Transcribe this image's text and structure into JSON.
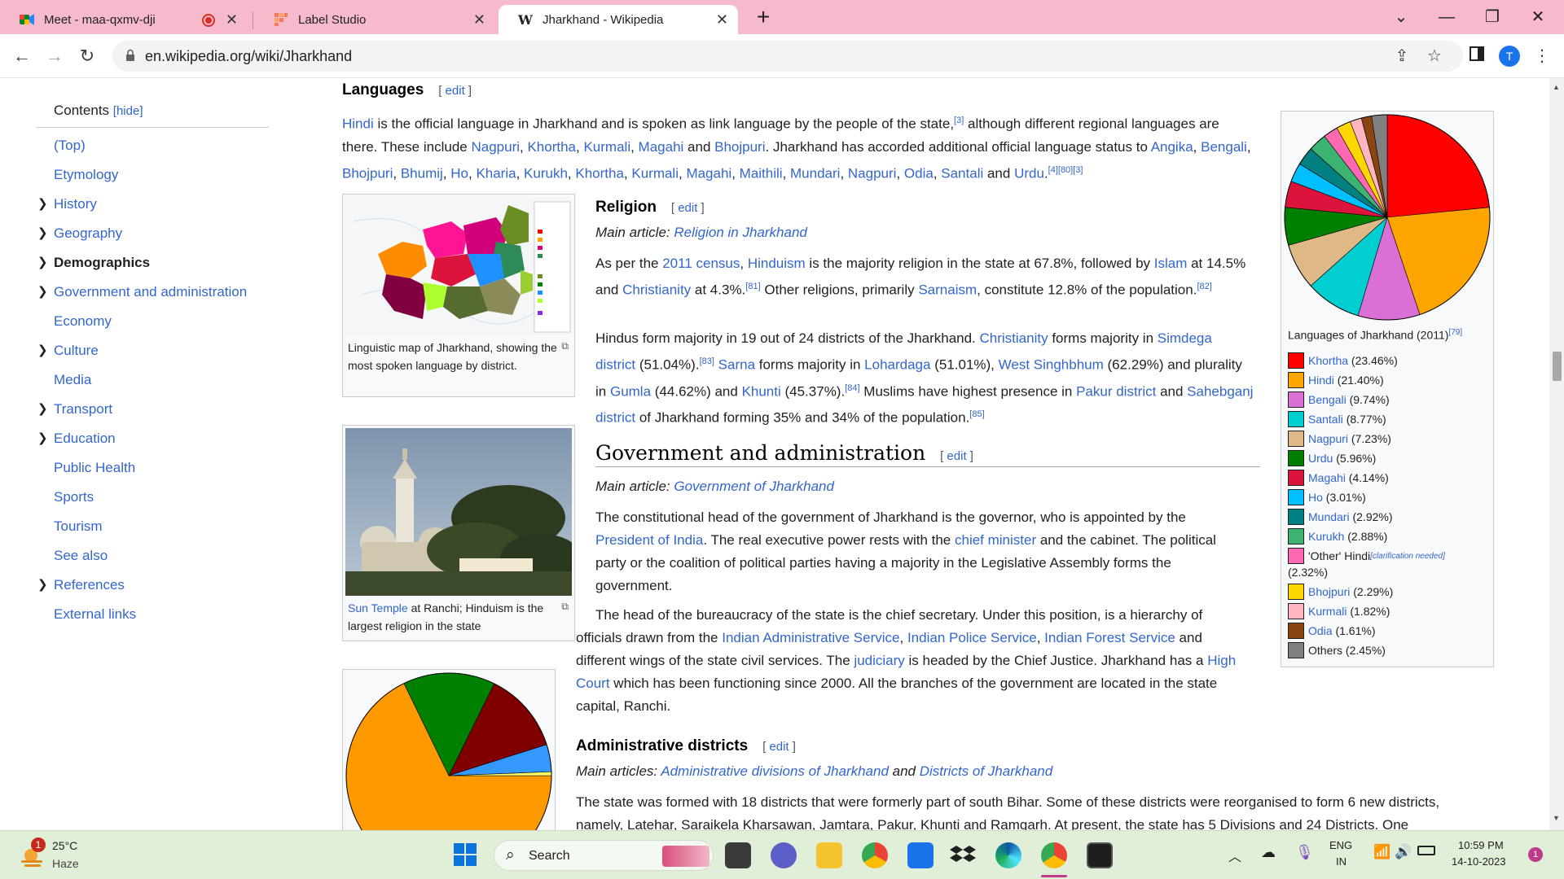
{
  "browser": {
    "tabs": [
      {
        "title": "Meet - maa-qxmv-dji",
        "recording": true
      },
      {
        "title": "Label Studio"
      },
      {
        "title": "Jharkhand - Wikipedia",
        "active": true
      }
    ],
    "url": "en.wikipedia.org/wiki/Jharkhand",
    "profile_initial": "T"
  },
  "toc": {
    "title": "Contents",
    "hide_label": "hide",
    "items": [
      {
        "label": "(Top)"
      },
      {
        "label": "Etymology"
      },
      {
        "label": "History",
        "expandable": true
      },
      {
        "label": "Geography",
        "expandable": true
      },
      {
        "label": "Demographics",
        "expandable": true,
        "active": true
      },
      {
        "label": "Government and administration",
        "expandable": true
      },
      {
        "label": "Economy"
      },
      {
        "label": "Culture",
        "expandable": true
      },
      {
        "label": "Media"
      },
      {
        "label": "Transport",
        "expandable": true
      },
      {
        "label": "Education",
        "expandable": true
      },
      {
        "label": "Public Health"
      },
      {
        "label": "Sports"
      },
      {
        "label": "Tourism"
      },
      {
        "label": "See also"
      },
      {
        "label": "References",
        "expandable": true
      },
      {
        "label": "External links"
      }
    ]
  },
  "article": {
    "edit_label": "edit",
    "languages": {
      "heading": "Languages",
      "p1": {
        "hindi": "Hindi",
        "t1": " is the official language in Jharkhand and is spoken as link language by the people of the state,",
        "ref1": "[3]",
        "t2": " although different regional languages are there. These include ",
        "l_nagpuri": "Nagpuri",
        "l_khortha": "Khortha",
        "l_kurmali": "Kurmali",
        "l_magahi": "Magahi",
        "t_and": " and ",
        "l_bhojpuri": "Bhojpuri",
        "t3": ". Jharkhand has accorded additional official language status to ",
        "list2": [
          "Angika",
          "Bengali",
          "Bhojpuri",
          "Bhumij",
          "Ho",
          "Kharia",
          "Kurukh",
          "Khortha",
          "Kurmali",
          "Magahi",
          "Maithili",
          "Mundari",
          "Nagpuri",
          "Odia",
          "Santali"
        ],
        "l_urdu": "Urdu",
        "refs": "[4][80][3]"
      }
    },
    "thumb_map": {
      "caption": "Linguistic map of Jharkhand, showing the most spoken language by district."
    },
    "thumb_temple": {
      "link": "Sun Temple",
      "caption_rest": " at Ranchi; Hinduism is the largest religion in the state"
    },
    "religion": {
      "heading": "Religion",
      "hatnote_prefix": "Main article: ",
      "hatnote_link": "Religion in Jharkhand",
      "p1": {
        "t0": "As per the ",
        "census": "2011 census",
        "hinduism": "Hinduism",
        "t1": " is the majority religion in the state at 67.8%, followed by ",
        "islam": "Islam",
        "t2": " at 14.5% and ",
        "christianity": "Christianity",
        "t3": " at 4.3%.",
        "ref81": "[81]",
        "t4": " Other religions, primarily ",
        "sarnaism": "Sarnaism",
        "t5": ", constitute 12.8% of the population.",
        "ref82": "[82]"
      },
      "p2": {
        "t0": "Hindus form majority in 19 out of 24 districts of the Jharkhand. ",
        "christianity": "Christianity",
        "t1": " forms majority in ",
        "simdega": "Simdega district",
        "t2": " (51.04%).",
        "ref83": "[83]",
        "sarna": "Sarna",
        "t3": " forms majority in ",
        "lohardaga": "Lohardaga",
        "t4": " (51.01%), ",
        "wsinghbhum": "West Singhbhum",
        "t5": " (62.29%) and plurality in ",
        "gumla": "Gumla",
        "t6": " (44.62%) and ",
        "khunti": "Khunti",
        "t7": " (45.37%).",
        "ref84": "[84]",
        "t8": " Muslims have highest presence in ",
        "pakur": "Pakur district",
        "t9": " and ",
        "sahebganj": "Sahebganj district",
        "t10": " of Jharkhand forming 35% and 34% of the population.",
        "ref85": "[85]"
      }
    },
    "government": {
      "heading": "Government and administration",
      "hatnote_prefix": "Main article: ",
      "hatnote_link": "Government of Jharkhand",
      "p1": {
        "t0": "The constitutional head of the government of Jharkhand is the governor, who is appointed by the ",
        "president": "President of India",
        "t1": ". The real executive power rests with the ",
        "cm": "chief minister",
        "t2": " and the cabinet. The political party or the coalition of political parties having a majority in the Legislative Assembly forms the government."
      },
      "p2": {
        "t0": "The head of the bureaucracy of the state is the chief secretary. Under this position, is a hierarchy of officials drawn from the ",
        "ias": "Indian Administrative Service",
        "ips": "Indian Police Service",
        "ifs": "Indian Forest Service",
        "t1": " and different wings of the state civil services. The ",
        "judiciary": "judiciary",
        "t2": " is headed by the Chief Justice. Jharkhand has a ",
        "hc": "High Court",
        "t3": " which has been functioning since 2000. All the branches of the government are located in the state capital, Ranchi."
      }
    },
    "districts": {
      "heading": "Administrative districts",
      "hatnote_prefix": "Main articles: ",
      "link1": "Administrative divisions of Jharkhand",
      "and": " and ",
      "link2": "Districts of Jharkhand",
      "p1": "The state was formed with 18 districts that were formerly part of south Bihar. Some of these districts were reorganised to form 6 new districts, namely, Latehar, Saraikela Kharsawan, Jamtara, Pakur, Khunti and Ramgarh. At present, the state has 5 Divisions and 24 Districts. One"
    }
  },
  "chart_data": [
    {
      "type": "pie",
      "title": "Languages of Jharkhand (2011)",
      "title_ref": "[79]",
      "clarification": "clarification needed",
      "series": [
        {
          "name": "Khortha",
          "value": 23.46,
          "color": "#ff0000",
          "link": true
        },
        {
          "name": "Hindi",
          "value": 21.4,
          "color": "#ffa500",
          "link": true
        },
        {
          "name": "Bengali",
          "value": 9.74,
          "color": "#da70d6",
          "link": true
        },
        {
          "name": "Santali",
          "value": 8.77,
          "color": "#00ced1",
          "link": true
        },
        {
          "name": "Nagpuri",
          "value": 7.23,
          "color": "#deb887",
          "link": true
        },
        {
          "name": "Urdu",
          "value": 5.96,
          "color": "#008000",
          "link": true
        },
        {
          "name": "Magahi",
          "value": 4.14,
          "color": "#dc143c",
          "link": true
        },
        {
          "name": "Ho",
          "value": 3.01,
          "color": "#00bfff",
          "link": true
        },
        {
          "name": "Mundari",
          "value": 2.92,
          "color": "#008080",
          "link": true
        },
        {
          "name": "Kurukh",
          "value": 2.88,
          "color": "#3cb371",
          "link": true
        },
        {
          "name": "'Other' Hindi",
          "value": 2.32,
          "color": "#ff69b4",
          "link": false
        },
        {
          "name": "Bhojpuri",
          "value": 2.29,
          "color": "#ffd700",
          "link": true
        },
        {
          "name": "Kurmali",
          "value": 1.82,
          "color": "#ffb6c1",
          "link": true
        },
        {
          "name": "Odia",
          "value": 1.61,
          "color": "#8b4513",
          "link": true
        },
        {
          "name": "Others",
          "value": 2.45,
          "color": "#808080",
          "link": false
        }
      ]
    },
    {
      "type": "pie",
      "series": [
        {
          "value": 67.8,
          "color": "#ff9900"
        },
        {
          "value": 14.5,
          "color": "#008000"
        },
        {
          "value": 12.8,
          "color": "#800000"
        },
        {
          "value": 4.3,
          "color": "#3399ff"
        },
        {
          "value": 0.6,
          "color": "#ffff66"
        }
      ]
    }
  ],
  "taskbar": {
    "weather_temp": "25°C",
    "weather_desc": "Haze",
    "weather_badge": "1",
    "search_label": "Search",
    "lang_top": "ENG",
    "lang_bottom": "IN",
    "time": "10:59 PM",
    "date": "14-10-2023",
    "notif_count": "1"
  }
}
